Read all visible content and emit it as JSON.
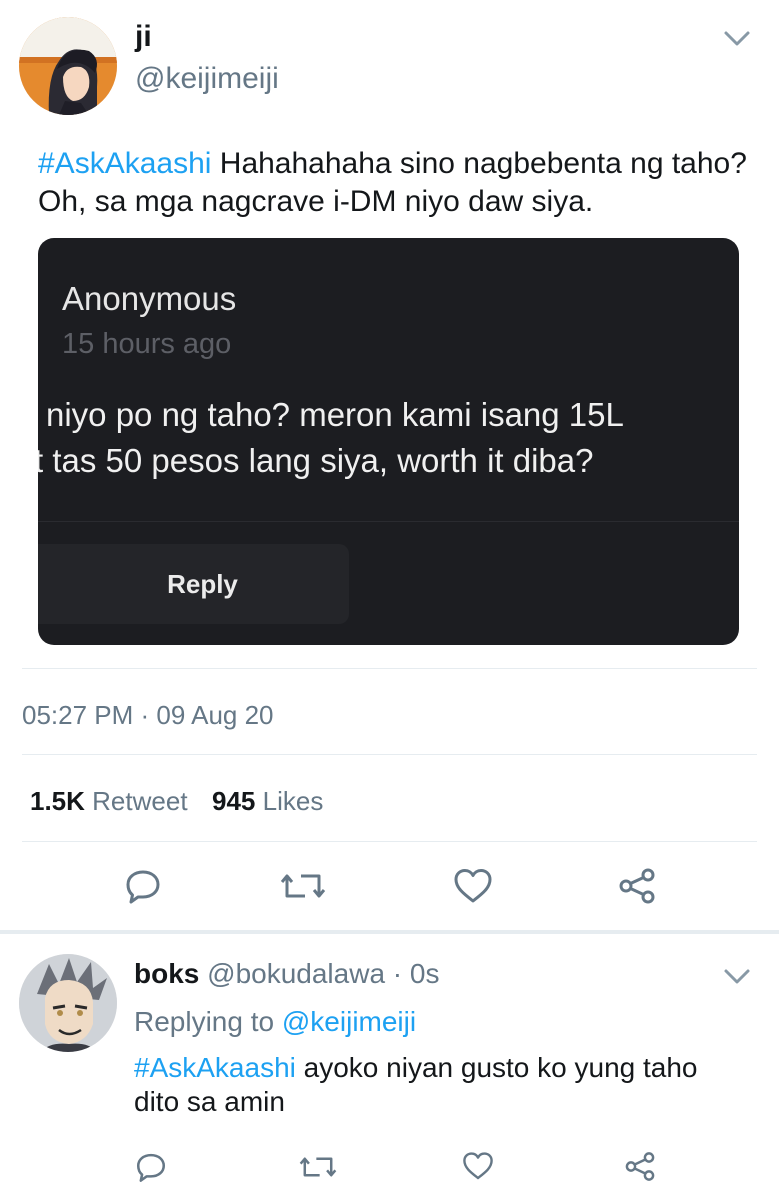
{
  "main_tweet": {
    "display_name": "ji",
    "handle": "@keijimeiji",
    "hashtag": "#AskAkaashi",
    "text": " Hahahahaha sino nagbebenta ng taho? Oh, sa mga nagcrave i-DM niyo daw siya.",
    "embedded_card": {
      "author": "Anonymous",
      "time": "15 hours ago",
      "line1": "niyo po ng taho? meron kami isang 15L",
      "line2": "t tas 50 pesos lang siya, worth it diba?",
      "reply_button": "Reply"
    },
    "timestamp": "05:27 PM · 09 Aug 20",
    "stats": {
      "retweets_count": "1.5K",
      "retweets_label": "Retweet",
      "likes_count": "945",
      "likes_label": "Likes"
    }
  },
  "reply_tweet": {
    "display_name": "boks",
    "handle": "@bokudalawa",
    "time": "· 0s",
    "replying_to_label": "Replying to ",
    "replying_to_handle": "@keijimeiji",
    "hashtag": "#AskAkaashi",
    "text": " ayoko niyan gusto ko yung taho dito sa amin"
  },
  "icons": {
    "reply": "reply-icon",
    "retweet": "retweet-icon",
    "like": "like-icon",
    "share": "share-icon",
    "chevron": "chevron-down-icon"
  },
  "colors": {
    "accent": "#1da1f2",
    "text": "#14171a",
    "muted": "#657786",
    "card_bg": "#1c1d21"
  }
}
